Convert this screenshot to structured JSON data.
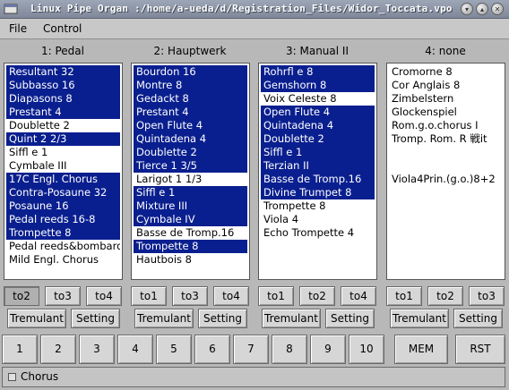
{
  "window": {
    "title": "Linux Pipe Organ :/home/a-ueda/d/Registration_Files/Widor_Toccata.vpo",
    "controls": [
      "minimize-icon",
      "maximize-icon",
      "close-icon"
    ]
  },
  "menubar": {
    "file": "File",
    "control": "Control"
  },
  "divisions": [
    {
      "title": "1: Pedal",
      "stops": [
        {
          "label": "Resultant 32",
          "selected": true
        },
        {
          "label": "Subbasso 16",
          "selected": true
        },
        {
          "label": "Diapasons 8",
          "selected": true
        },
        {
          "label": "Prestant 4",
          "selected": true
        },
        {
          "label": "Doublette 2",
          "selected": false
        },
        {
          "label": "Quint 2 2/3",
          "selected": true
        },
        {
          "label": "Siffl    e 1",
          "selected": false
        },
        {
          "label": "Cymbale III",
          "selected": false
        },
        {
          "label": "17C Engl. Chorus",
          "selected": true
        },
        {
          "label": "Contra-Posaune 32",
          "selected": true
        },
        {
          "label": "Posaune 16",
          "selected": true
        },
        {
          "label": "Pedal reeds 16-8",
          "selected": true
        },
        {
          "label": "Trompette 8",
          "selected": true
        },
        {
          "label": "Pedal reeds&bombarde",
          "selected": false
        },
        {
          "label": "Mild Engl. Chorus",
          "selected": false
        }
      ],
      "couplers": [
        {
          "label": "to2",
          "pressed": true
        },
        {
          "label": "to3",
          "pressed": false
        },
        {
          "label": "to4",
          "pressed": false
        }
      ],
      "tremulant": "Tremulant",
      "setting": "Setting"
    },
    {
      "title": "2: Hauptwerk",
      "stops": [
        {
          "label": "Bourdon 16",
          "selected": true
        },
        {
          "label": "Montre 8",
          "selected": true
        },
        {
          "label": "Gedackt 8",
          "selected": true
        },
        {
          "label": "Prestant 4",
          "selected": true
        },
        {
          "label": "Open Flute 4",
          "selected": true
        },
        {
          "label": "Quintadena 4",
          "selected": true
        },
        {
          "label": "Doublette 2",
          "selected": true
        },
        {
          "label": "Tierce 1 3/5",
          "selected": true
        },
        {
          "label": "Larigot 1 1/3",
          "selected": false
        },
        {
          "label": "Siffl    e 1",
          "selected": true
        },
        {
          "label": "Mixture III",
          "selected": true
        },
        {
          "label": "Cymbale IV",
          "selected": true
        },
        {
          "label": "Basse de Tromp.16",
          "selected": false
        },
        {
          "label": "Trompette 8",
          "selected": true
        },
        {
          "label": "Hautbois 8",
          "selected": false
        }
      ],
      "couplers": [
        {
          "label": "to1",
          "pressed": false
        },
        {
          "label": "to3",
          "pressed": false
        },
        {
          "label": "to4",
          "pressed": false
        }
      ],
      "tremulant": "Tremulant",
      "setting": "Setting"
    },
    {
      "title": "3: Manual  II",
      "stops": [
        {
          "label": "Rohrfl    e 8",
          "selected": true
        },
        {
          "label": "Gemshorn 8",
          "selected": true
        },
        {
          "label": "Voix Celeste 8",
          "selected": false
        },
        {
          "label": "Open Flute 4",
          "selected": true
        },
        {
          "label": "Quintadena 4",
          "selected": true
        },
        {
          "label": "Doublette 2",
          "selected": true
        },
        {
          "label": "Siffl    e 1",
          "selected": true
        },
        {
          "label": "Terzian II",
          "selected": true
        },
        {
          "label": "Basse de Tromp.16",
          "selected": true
        },
        {
          "label": "Divine Trumpet 8",
          "selected": true
        },
        {
          "label": "Trompette 8",
          "selected": false
        },
        {
          "label": "Viola 4",
          "selected": false
        },
        {
          "label": "Echo Trompette 4",
          "selected": false
        }
      ],
      "couplers": [
        {
          "label": "to1",
          "pressed": false
        },
        {
          "label": "to2",
          "pressed": false
        },
        {
          "label": "to4",
          "pressed": false
        }
      ],
      "tremulant": "Tremulant",
      "setting": "Setting"
    },
    {
      "title": "4: none",
      "stops": [
        {
          "label": "Cromorne 8",
          "selected": false
        },
        {
          "label": "Cor Anglais 8",
          "selected": false
        },
        {
          "label": "Zimbelstern",
          "selected": false
        },
        {
          "label": "Glockenspiel",
          "selected": false
        },
        {
          "label": "Rom.g.o.chorus I",
          "selected": false
        },
        {
          "label": "Tromp. Rom. R 戦it",
          "selected": false
        },
        {
          "label": "",
          "selected": false
        },
        {
          "label": "",
          "selected": false
        },
        {
          "label": "Viola4Prin.(g.o.)8+2",
          "selected": false
        }
      ],
      "couplers": [
        {
          "label": "to1",
          "pressed": false
        },
        {
          "label": "to2",
          "pressed": false
        },
        {
          "label": "to3",
          "pressed": false
        }
      ],
      "tremulant": "Tremulant",
      "setting": "Setting"
    }
  ],
  "presets": [
    "1",
    "2",
    "3",
    "4",
    "5",
    "6",
    "7",
    "8",
    "9",
    "10"
  ],
  "mem": "MEM",
  "rst": "RST",
  "chorus": {
    "label": "Chorus",
    "checked": false
  }
}
